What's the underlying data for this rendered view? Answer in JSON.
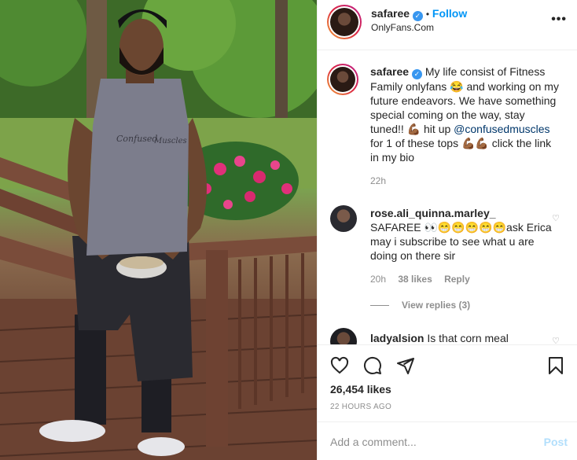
{
  "post": {
    "username": "safaree",
    "follow_label": "Follow",
    "dot": "•",
    "subtitle": "OnlyFans.Com",
    "more_label": "•••",
    "caption": {
      "username": "safaree",
      "text_1": "My life consist of Fitness Family onlyfans 😂 and working on my future endeavors. We have something special coming on the way, stay tuned!! 💪🏾 hit up ",
      "mention": "@confusedmuscles",
      "text_2": " for 1 of these tops 💪🏾💪🏾 click the link in my bio",
      "time": "22h"
    },
    "comments": [
      {
        "username": "rose.ali_quinna.marley_",
        "text": "SAFAREE 👀😁😁😁😁😁ask Erica may i subscribe to see what u are doing on there sir",
        "time": "20h",
        "likes": "38 likes",
        "reply": "Reply",
        "view_replies": "View replies (3)"
      },
      {
        "username": "ladyalsion",
        "text": "Is that corn meal"
      }
    ],
    "likes": "26,454 likes",
    "ago": "22 HOURS AGO",
    "add_comment_placeholder": "Add a comment...",
    "post_label": "Post",
    "verified_glyph": "✓",
    "photo_print_top": "Confused",
    "photo_print_bottom": "Muscles"
  },
  "icons": [
    "heart-icon",
    "comment-icon",
    "share-icon",
    "bookmark-icon",
    "more-icon",
    "verified-icon"
  ]
}
